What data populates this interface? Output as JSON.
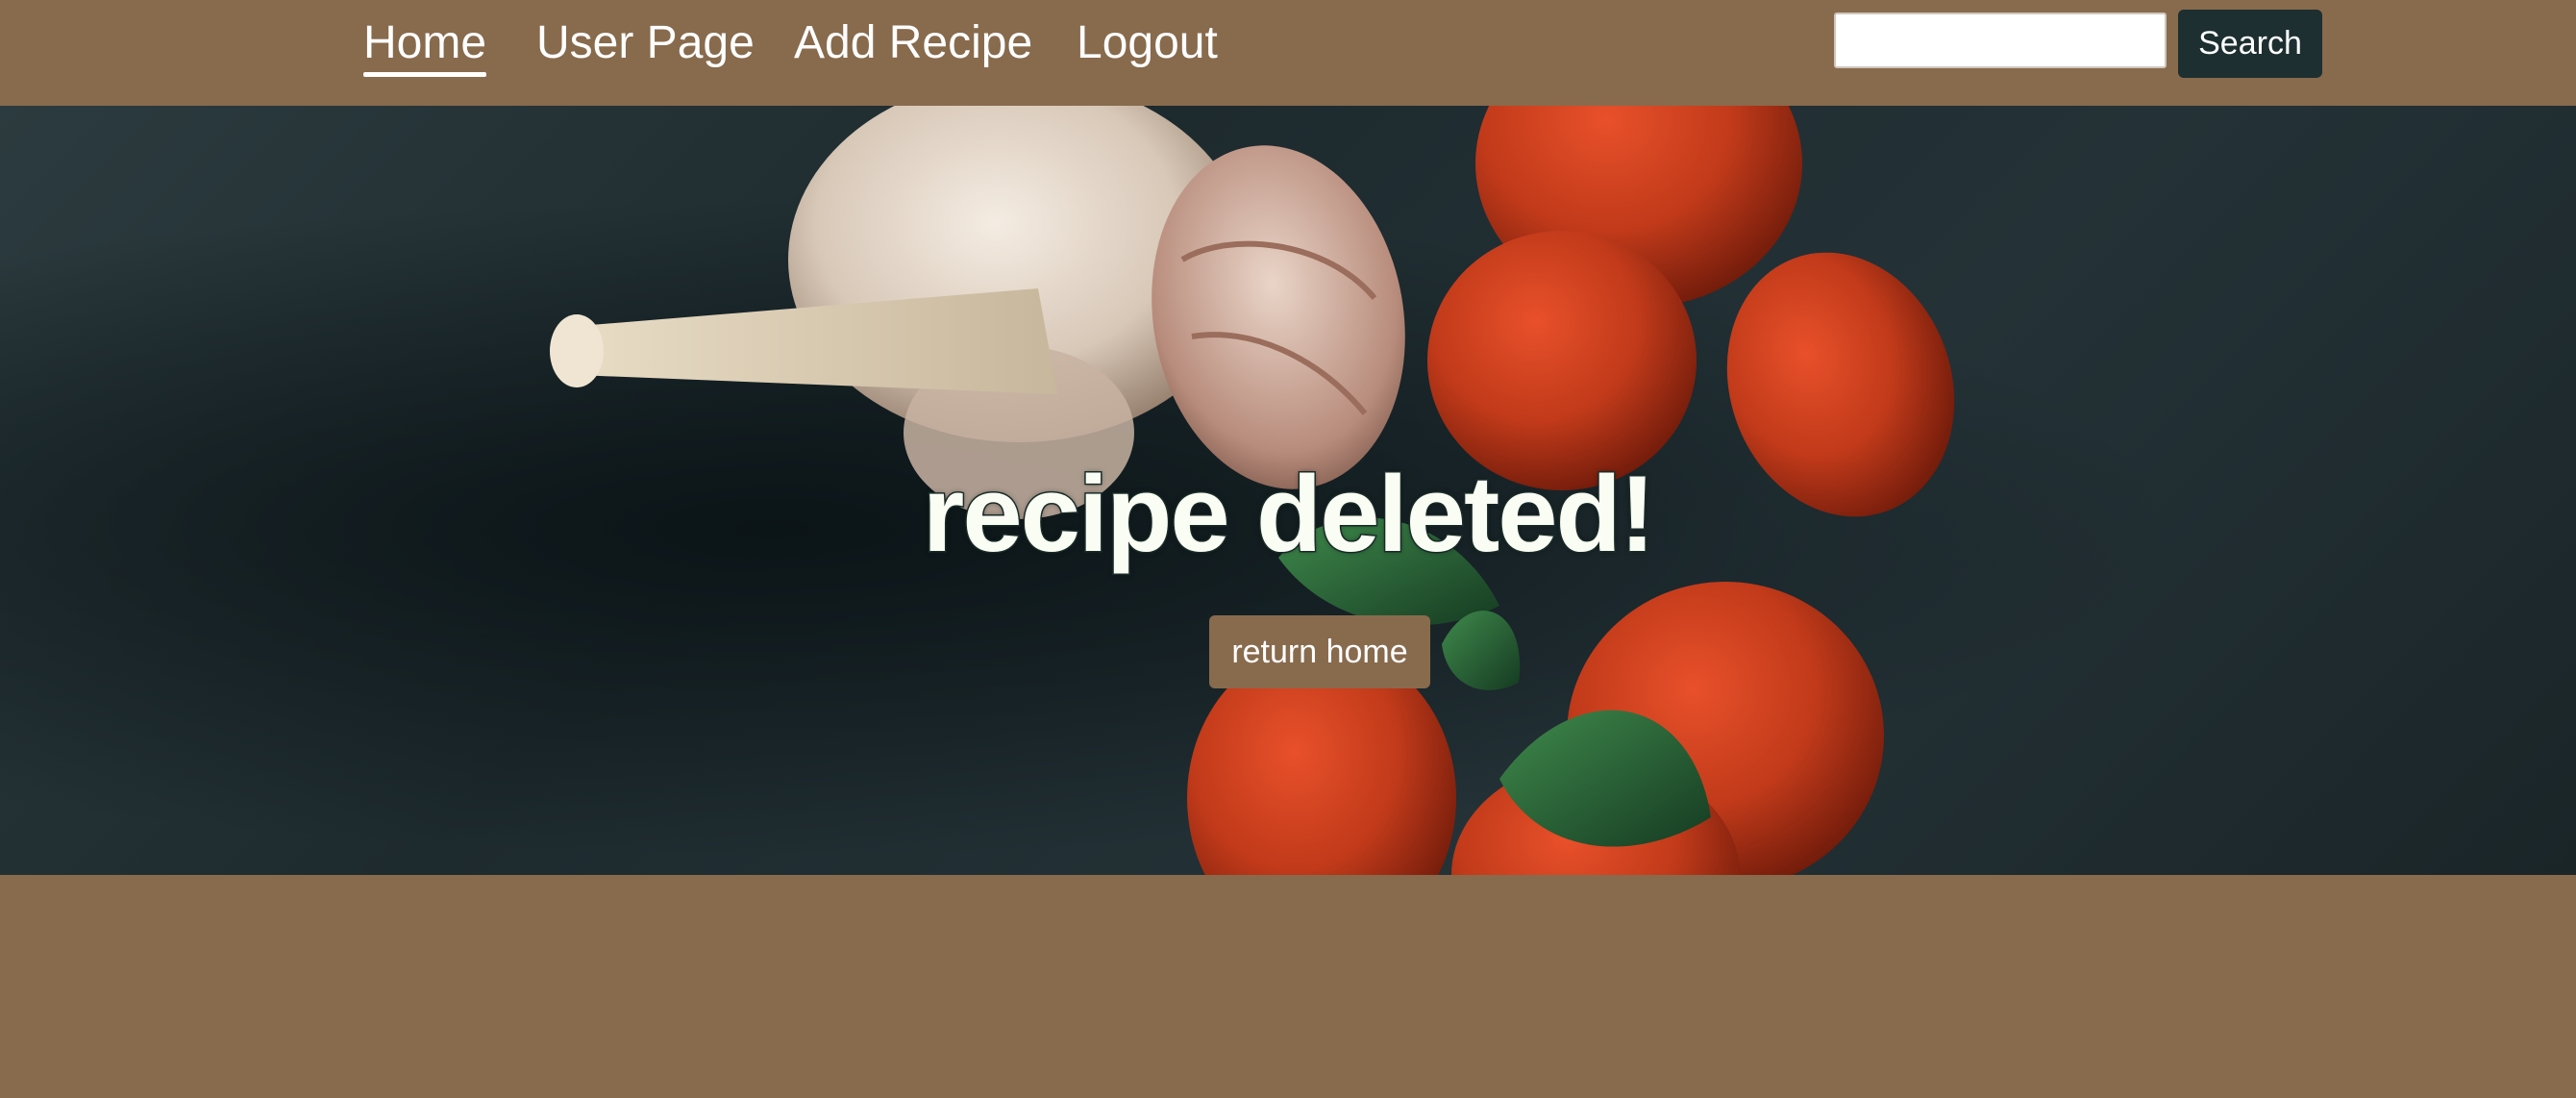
{
  "nav": {
    "items": [
      {
        "label": "Home",
        "active": true
      },
      {
        "label": "User Page",
        "active": false
      },
      {
        "label": "Add Recipe",
        "active": false
      },
      {
        "label": "Logout",
        "active": false
      }
    ],
    "search": {
      "value": "",
      "placeholder": "",
      "button_label": "Search"
    }
  },
  "hero": {
    "title": "recipe deleted!",
    "button_label": "return home",
    "background_image": "garlic-tomatoes-basil-on-slate"
  },
  "colors": {
    "brand": "#886a4d",
    "search_button": "#1d2f30",
    "hero_title": "#fafdf3",
    "text_light": "#ffffff"
  }
}
